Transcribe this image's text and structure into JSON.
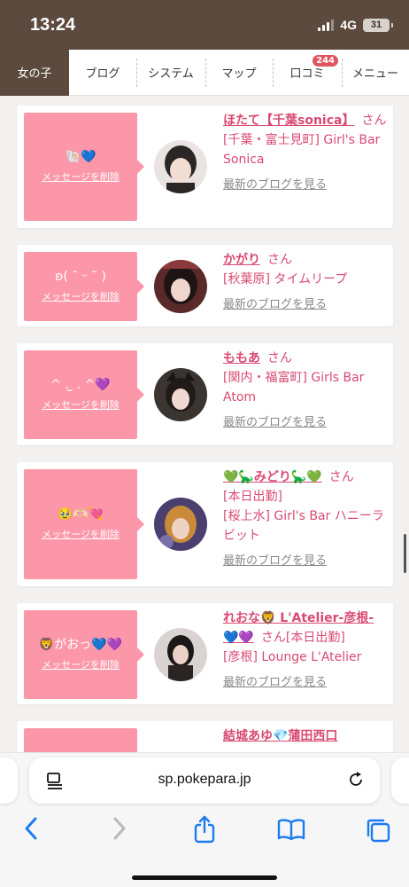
{
  "status": {
    "time": "13:24",
    "network": "4G",
    "battery": "31"
  },
  "nav": {
    "items": [
      {
        "label": "女の子",
        "active": true
      },
      {
        "label": "ブログ"
      },
      {
        "label": "システム"
      },
      {
        "label": "マップ"
      },
      {
        "label": "口コミ",
        "badge": "244"
      },
      {
        "label": "メニュー"
      }
    ]
  },
  "cards": [
    {
      "message": "🐚💙",
      "delete_label": "メッセージを削除",
      "name": "ほたて【千葉sonica】",
      "san": "さん",
      "shop_lines": [
        "[千葉・富士見町] Girl's Bar Sonica"
      ],
      "blog_label": "最新のブログを見る"
    },
    {
      "message": "ʚ( ˘ ᵕ ˘ )",
      "delete_label": "メッセージを削除",
      "name": "かがり",
      "san": "さん",
      "shop_lines": [
        "[秋葉原] タイムリープ"
      ],
      "blog_label": "最新のブログを見る"
    },
    {
      "message": "^ . ̫ . ^💜",
      "delete_label": "メッセージを削除",
      "name": "ももあ",
      "san": "さん",
      "shop_lines": [
        "[関内・福富町] Girls Bar Atom"
      ],
      "blog_label": "最新のブログを見る"
    },
    {
      "message": "🥹🫶🏻💘",
      "delete_label": "メッセージを削除",
      "name": "💚🦕みどり🦕💚",
      "san": "さん",
      "shop_lines": [
        "[本日出勤]",
        "[桜上水] Girl's Bar ハニーラビット"
      ],
      "blog_label": "最新のブログを見る"
    },
    {
      "message": "🦁がおっ💙💜",
      "delete_label": "メッセージを削除",
      "name": "れおな🦁 L'Atelier-彦根-💙💜",
      "san": "さん[本日出勤]",
      "shop_lines": [
        "[彦根] Lounge L'Atelier"
      ],
      "blog_label": "最新のブログを見る"
    },
    {
      "message": "",
      "delete_label": "",
      "name": "結城あゆ💎蒲田西口",
      "san": "",
      "shop_lines": [],
      "blog_label": ""
    }
  ],
  "browser": {
    "url": "sp.pokepara.jp"
  },
  "colors": {
    "accent": "#d94a72",
    "message_bg": "#fb97a8",
    "header_brown": "#5b4a3d"
  }
}
